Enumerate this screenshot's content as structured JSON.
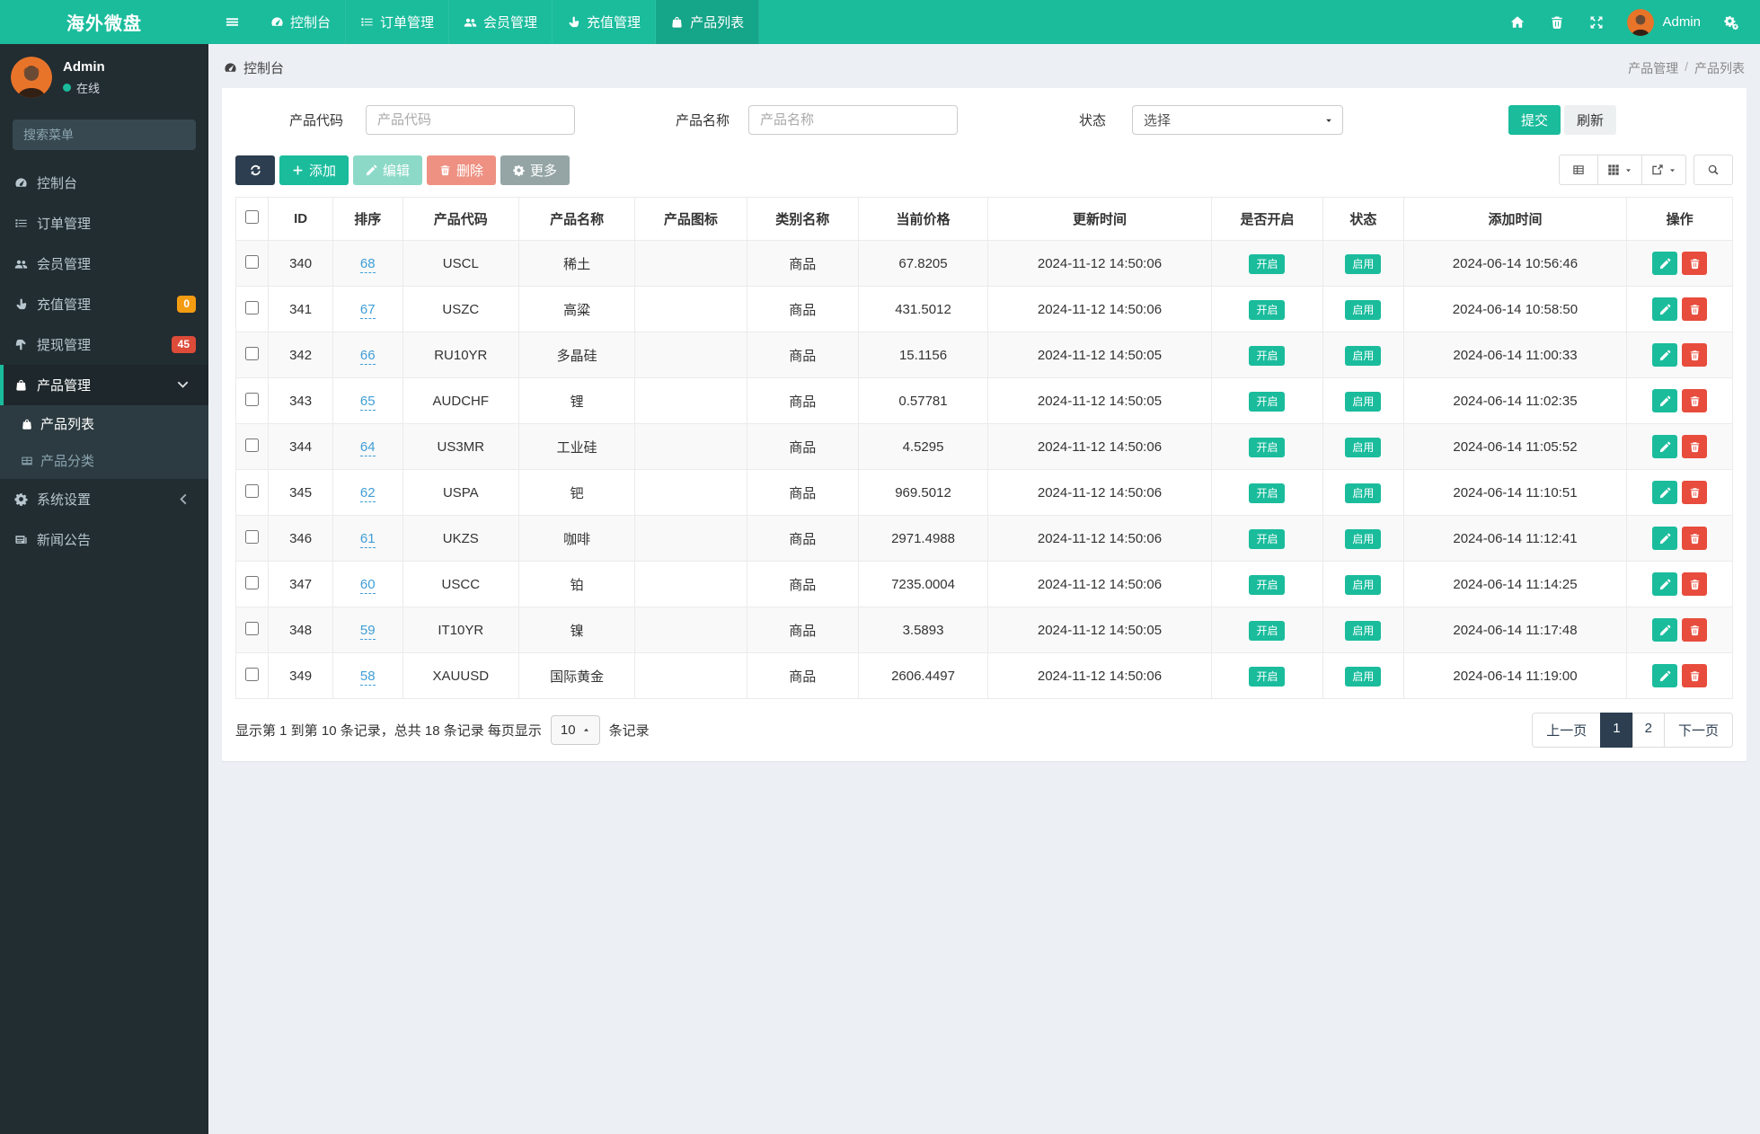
{
  "brand": "海外微盘",
  "colors": {
    "accent": "#1abc9c",
    "accent_dark": "#15a589",
    "navy": "#2c3e50",
    "danger": "#e74c3c",
    "badge_orange": "#f39c12",
    "badge_red": "#dd4b39",
    "sidebar_bg": "#222d32",
    "content_bg": "#ecf0f5"
  },
  "topnav": {
    "items": [
      {
        "label": "控制台",
        "icon": "dashboard-icon",
        "active": false
      },
      {
        "label": "订单管理",
        "icon": "list-icon",
        "active": false
      },
      {
        "label": "会员管理",
        "icon": "users-icon",
        "active": false
      },
      {
        "label": "充值管理",
        "icon": "hand-up-icon",
        "active": false
      },
      {
        "label": "产品列表",
        "icon": "bag-icon",
        "active": true
      }
    ],
    "right_icons": [
      "home-icon",
      "trash-icon",
      "expand-icon"
    ],
    "user_label": "Admin",
    "settings_icon": "gears-icon"
  },
  "sidebar": {
    "user": {
      "name": "Admin",
      "status": "在线"
    },
    "search_placeholder": "搜索菜单",
    "items": [
      {
        "label": "控制台",
        "icon": "dashboard-icon"
      },
      {
        "label": "订单管理",
        "icon": "list-icon"
      },
      {
        "label": "会员管理",
        "icon": "users-icon"
      },
      {
        "label": "充值管理",
        "icon": "hand-up-icon",
        "badge": "0",
        "badge_color": "#f39c12"
      },
      {
        "label": "提现管理",
        "icon": "hand-down-icon",
        "badge": "45",
        "badge_color": "#dd4b39"
      },
      {
        "label": "产品管理",
        "icon": "bag-icon",
        "active": true,
        "chevron": "down",
        "children": [
          {
            "label": "产品列表",
            "icon": "bag-icon",
            "active": true
          },
          {
            "label": "产品分类",
            "icon": "table-icon",
            "active": false
          }
        ]
      },
      {
        "label": "系统设置",
        "icon": "gear-icon",
        "chevron": "left"
      },
      {
        "label": "新闻公告",
        "icon": "news-icon"
      }
    ]
  },
  "header": {
    "title": "控制台",
    "title_icon": "dashboard-icon",
    "breadcrumb_parent": "产品管理",
    "breadcrumb_sep": "/",
    "breadcrumb_current": "产品列表"
  },
  "filters": {
    "code_label": "产品代码",
    "code_placeholder": "产品代码",
    "name_label": "产品名称",
    "name_placeholder": "产品名称",
    "status_label": "状态",
    "status_value": "选择",
    "submit_label": "提交",
    "refresh_label": "刷新"
  },
  "toolbar": {
    "refresh_icon": "refresh-icon",
    "add_label": "添加",
    "edit_label": "编辑",
    "delete_label": "删除",
    "more_label": "更多",
    "view_icons": [
      "th-list-icon",
      "th-icon",
      "export-icon"
    ],
    "search_icon": "search-icon"
  },
  "table": {
    "columns": [
      "ID",
      "排序",
      "产品代码",
      "产品名称",
      "产品图标",
      "类别名称",
      "当前价格",
      "更新时间",
      "是否开启",
      "状态",
      "添加时间",
      "操作"
    ],
    "badges": {
      "open": "开启",
      "status": "启用"
    },
    "ops_icons": [
      "pencil-icon",
      "trash-icon"
    ],
    "rows": [
      {
        "id": "340",
        "sort": "68",
        "code": "USCL",
        "name": "稀土",
        "category": "商品",
        "price": "67.8205",
        "updated": "2024-11-12 14:50:06",
        "added": "2024-06-14 10:56:46"
      },
      {
        "id": "341",
        "sort": "67",
        "code": "USZC",
        "name": "高粱",
        "category": "商品",
        "price": "431.5012",
        "updated": "2024-11-12 14:50:06",
        "added": "2024-06-14 10:58:50"
      },
      {
        "id": "342",
        "sort": "66",
        "code": "RU10YR",
        "name": "多晶硅",
        "category": "商品",
        "price": "15.1156",
        "updated": "2024-11-12 14:50:05",
        "added": "2024-06-14 11:00:33"
      },
      {
        "id": "343",
        "sort": "65",
        "code": "AUDCHF",
        "name": "锂",
        "category": "商品",
        "price": "0.57781",
        "updated": "2024-11-12 14:50:05",
        "added": "2024-06-14 11:02:35"
      },
      {
        "id": "344",
        "sort": "64",
        "code": "US3MR",
        "name": "工业硅",
        "category": "商品",
        "price": "4.5295",
        "updated": "2024-11-12 14:50:06",
        "added": "2024-06-14 11:05:52"
      },
      {
        "id": "345",
        "sort": "62",
        "code": "USPA",
        "name": "钯",
        "category": "商品",
        "price": "969.5012",
        "updated": "2024-11-12 14:50:06",
        "added": "2024-06-14 11:10:51"
      },
      {
        "id": "346",
        "sort": "61",
        "code": "UKZS",
        "name": "咖啡",
        "category": "商品",
        "price": "2971.4988",
        "updated": "2024-11-12 14:50:06",
        "added": "2024-06-14 11:12:41"
      },
      {
        "id": "347",
        "sort": "60",
        "code": "USCC",
        "name": "铂",
        "category": "商品",
        "price": "7235.0004",
        "updated": "2024-11-12 14:50:06",
        "added": "2024-06-14 11:14:25"
      },
      {
        "id": "348",
        "sort": "59",
        "code": "IT10YR",
        "name": "镍",
        "category": "商品",
        "price": "3.5893",
        "updated": "2024-11-12 14:50:05",
        "added": "2024-06-14 11:17:48"
      },
      {
        "id": "349",
        "sort": "58",
        "code": "XAUUSD",
        "name": "国际黄金",
        "category": "商品",
        "price": "2606.4497",
        "updated": "2024-11-12 14:50:06",
        "added": "2024-06-14 11:19:00"
      }
    ]
  },
  "pagination": {
    "info_prefix": "显示第 1 到第 10 条记录，总共 18 条记录 每页显示",
    "page_size": "10",
    "info_suffix": "条记录",
    "prev_label": "上一页",
    "pages": [
      "1",
      "2"
    ],
    "active_page": "1",
    "next_label": "下一页"
  }
}
